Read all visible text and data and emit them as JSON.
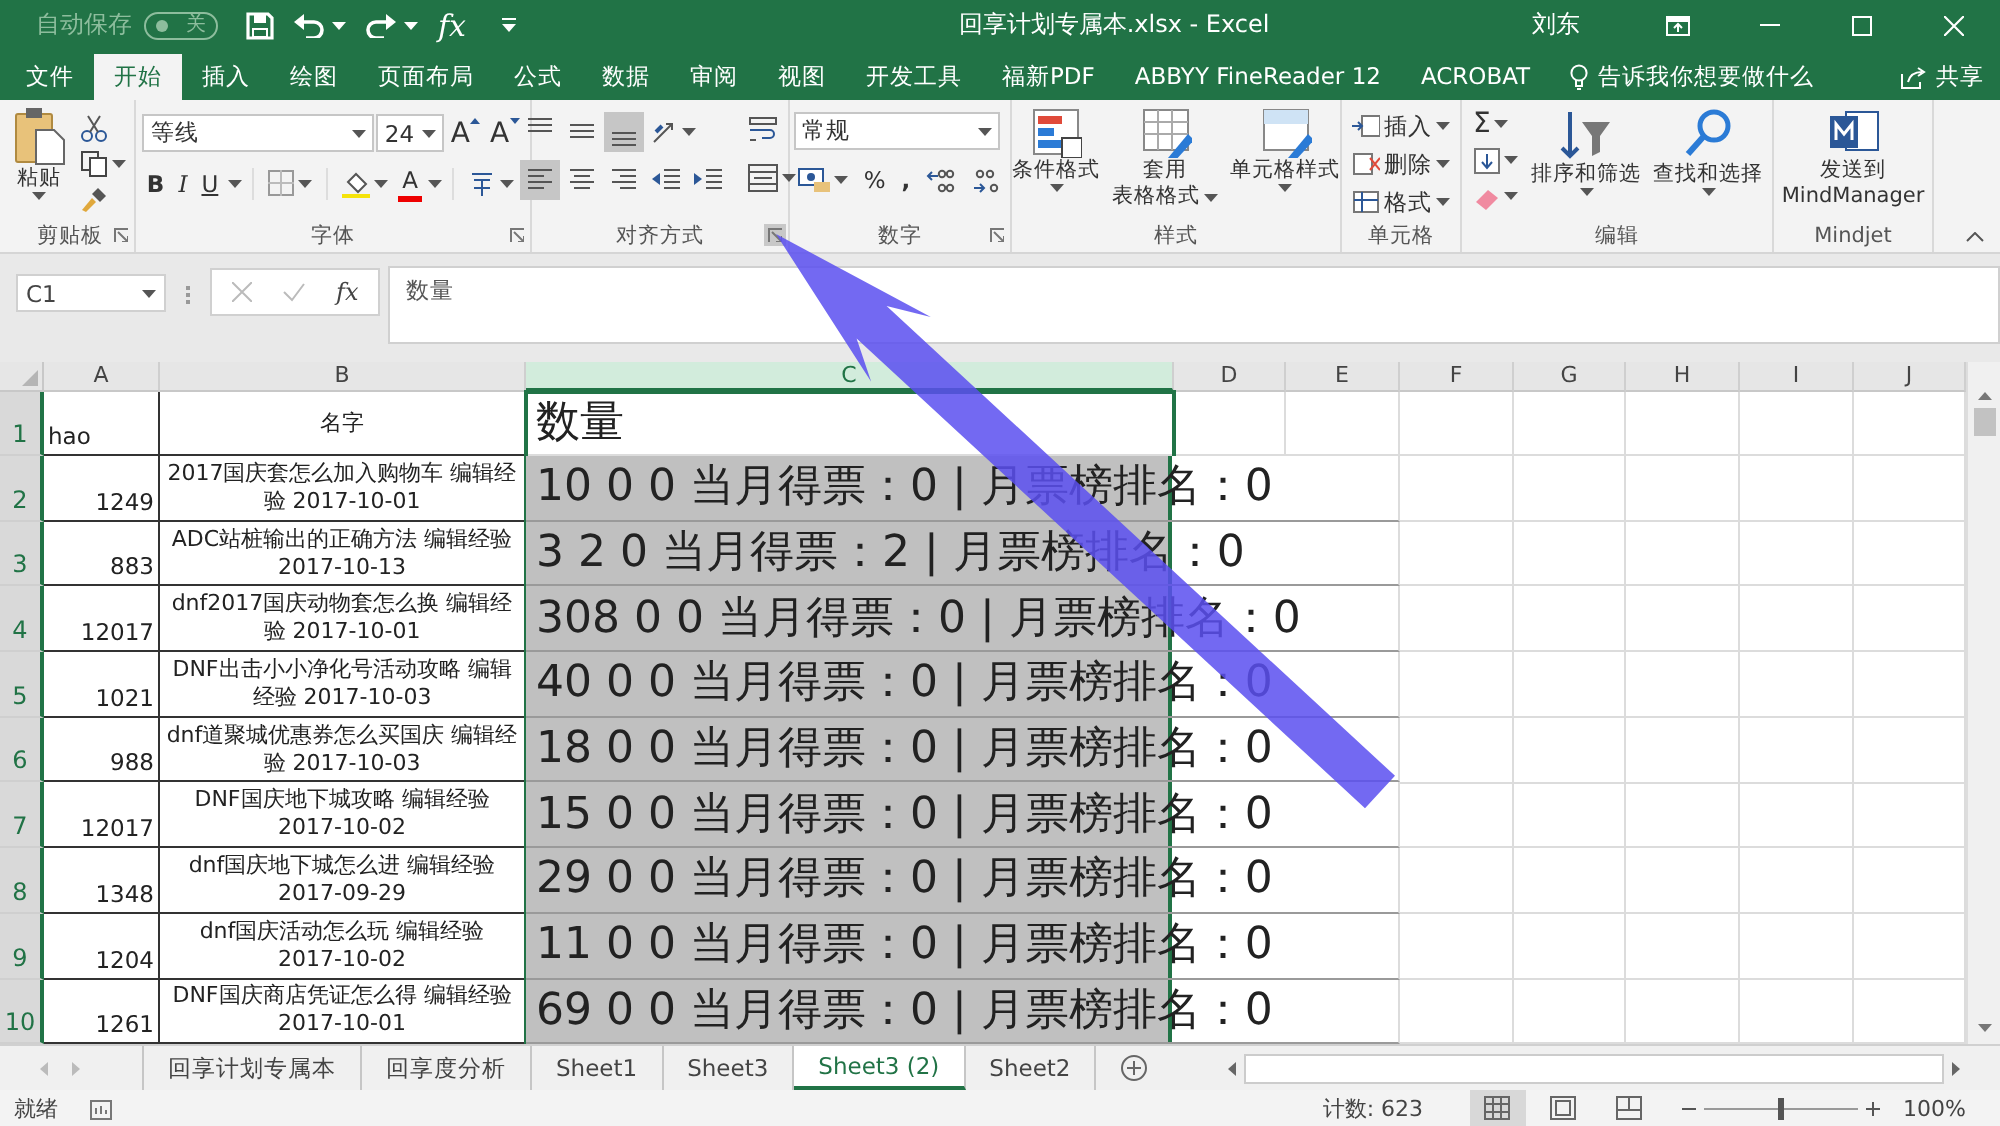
{
  "quick_access": {
    "autosave_label": "自动保存",
    "autosave_toggle": {
      "on": false,
      "label": "关"
    },
    "fx": "fx"
  },
  "window": {
    "title": "回享计划专属本.xlsx  -  Excel",
    "user": "刘东"
  },
  "ribbon_tabs": [
    {
      "label": "文件",
      "selected": false
    },
    {
      "label": "开始",
      "selected": true
    },
    {
      "label": "插入",
      "selected": false
    },
    {
      "label": "绘图",
      "selected": false
    },
    {
      "label": "页面布局",
      "selected": false
    },
    {
      "label": "公式",
      "selected": false
    },
    {
      "label": "数据",
      "selected": false
    },
    {
      "label": "审阅",
      "selected": false
    },
    {
      "label": "视图",
      "selected": false
    },
    {
      "label": "开发工具",
      "selected": false
    },
    {
      "label": "福新PDF",
      "selected": false
    },
    {
      "label": "ABBYY FineReader 12",
      "selected": false
    },
    {
      "label": "ACROBAT",
      "selected": false
    }
  ],
  "tell_me": "告诉我你想要做什么",
  "share": "共享",
  "ribbon": {
    "groups": [
      {
        "kind": "clipboard",
        "label": "剪贴板",
        "launcher": true,
        "launcher_hovered": false,
        "paste": "粘贴"
      },
      {
        "kind": "font",
        "label": "字体",
        "launcher": true,
        "launcher_hovered": false,
        "font_name": "等线",
        "font_size": "24",
        "grow": "A",
        "shrink": "A",
        "bold": "B",
        "italic": "I",
        "underline": "U",
        "font_color": "A"
      },
      {
        "kind": "alignment",
        "label": "对齐方式",
        "launcher": true,
        "launcher_hovered": true,
        "vertical": [
          {
            "selected": false
          },
          {
            "selected": false
          },
          {
            "selected": true
          }
        ],
        "horizontal": [
          {
            "selected": true
          },
          {
            "selected": false
          },
          {
            "selected": false
          }
        ]
      },
      {
        "kind": "number",
        "label": "数字",
        "launcher": true,
        "launcher_hovered": false,
        "format": "常规",
        "percent": "%",
        "comma": ","
      },
      {
        "kind": "styles",
        "label": "样式",
        "launcher": false,
        "buttons": [
          [
            "条件格式"
          ],
          [
            "套用",
            "表格格式"
          ],
          [
            "单元格样式"
          ]
        ]
      },
      {
        "kind": "cells",
        "label": "单元格",
        "launcher": false,
        "buttons": [
          "插入",
          "删除",
          "格式"
        ]
      },
      {
        "kind": "editing",
        "label": "编辑",
        "launcher": false,
        "autosum": "Σ",
        "buttons": [
          "排序和筛选",
          "查找和选择"
        ]
      },
      {
        "kind": "addin",
        "label": "Mindjet",
        "launcher": false,
        "button": [
          "发送到",
          "MindManager"
        ]
      }
    ]
  },
  "formula_bar": {
    "name_box": "C1",
    "fx": "fx",
    "content": "数量"
  },
  "sheet": {
    "columns": [
      {
        "label": "A",
        "selected": false
      },
      {
        "label": "B",
        "selected": false
      },
      {
        "label": "C",
        "selected": true
      },
      {
        "label": "D",
        "selected": false
      },
      {
        "label": "E",
        "selected": false
      },
      {
        "label": "F",
        "selected": false
      },
      {
        "label": "G",
        "selected": false
      },
      {
        "label": "H",
        "selected": false
      },
      {
        "label": "I",
        "selected": false
      },
      {
        "label": "J",
        "selected": false
      }
    ],
    "rows": [
      {
        "number": "1",
        "selected": true,
        "shaded": false,
        "a": "hao",
        "b": "名字",
        "c": "数量"
      },
      {
        "number": "2",
        "selected": true,
        "shaded": true,
        "a": "1249",
        "b": "2017国庆套怎么加入购物车 编辑经验 2017-10-01",
        "c": "10 0 0 当月得票：0 | 月票榜排名：0"
      },
      {
        "number": "3",
        "selected": true,
        "shaded": true,
        "a": "883",
        "b": "ADC站桩输出的正确方法 编辑经验 2017-10-13",
        "c": "3 2 0 当月得票：2 | 月票榜排名：0"
      },
      {
        "number": "4",
        "selected": true,
        "shaded": true,
        "a": "12017",
        "b": "dnf2017国庆动物套怎么换 编辑经验 2017-10-01",
        "c": "308 0 0 当月得票：0 | 月票榜排名：0"
      },
      {
        "number": "5",
        "selected": true,
        "shaded": true,
        "a": "1021",
        "b": "DNF出击小小净化号活动攻略 编辑经验 2017-10-03",
        "c": "40 0 0 当月得票：0 | 月票榜排名：0"
      },
      {
        "number": "6",
        "selected": true,
        "shaded": true,
        "a": "988",
        "b": "dnf道聚城优惠券怎么买国庆 编辑经验 2017-10-03",
        "c": "18 0 0 当月得票：0 | 月票榜排名：0"
      },
      {
        "number": "7",
        "selected": true,
        "shaded": true,
        "a": "12017",
        "b": "DNF国庆地下城攻略 编辑经验 2017-10-02",
        "c": "15 0 0 当月得票：0 | 月票榜排名：0"
      },
      {
        "number": "8",
        "selected": true,
        "shaded": true,
        "a": "1348",
        "b": "dnf国庆地下城怎么进 编辑经验 2017-09-29",
        "c": "29 0 0 当月得票：0 | 月票榜排名：0"
      },
      {
        "number": "9",
        "selected": true,
        "shaded": true,
        "a": "1204",
        "b": "dnf国庆活动怎么玩 编辑经验 2017-10-02",
        "c": "11 0 0 当月得票：0 | 月票榜排名：0"
      },
      {
        "number": "10",
        "selected": true,
        "shaded": true,
        "a": "1261",
        "b": "DNF国庆商店凭证怎么得 编辑经验 2017-10-01",
        "c": "69 0 0 当月得票：0 | 月票榜排名：0"
      }
    ]
  },
  "sheet_tabs": [
    {
      "label": "回享计划专属本",
      "selected": false
    },
    {
      "label": "回享度分析",
      "selected": false
    },
    {
      "label": "Sheet1",
      "selected": false
    },
    {
      "label": "Sheet3",
      "selected": false
    },
    {
      "label": "Sheet3 (2)",
      "selected": true
    },
    {
      "label": "Sheet2",
      "selected": false
    }
  ],
  "status_bar": {
    "state": "就绪",
    "count": "计数: 623",
    "views": [
      {
        "selected": true
      },
      {
        "selected": false
      },
      {
        "selected": false
      }
    ],
    "zoom": {
      "level": 0.5,
      "reading": "100%"
    }
  }
}
